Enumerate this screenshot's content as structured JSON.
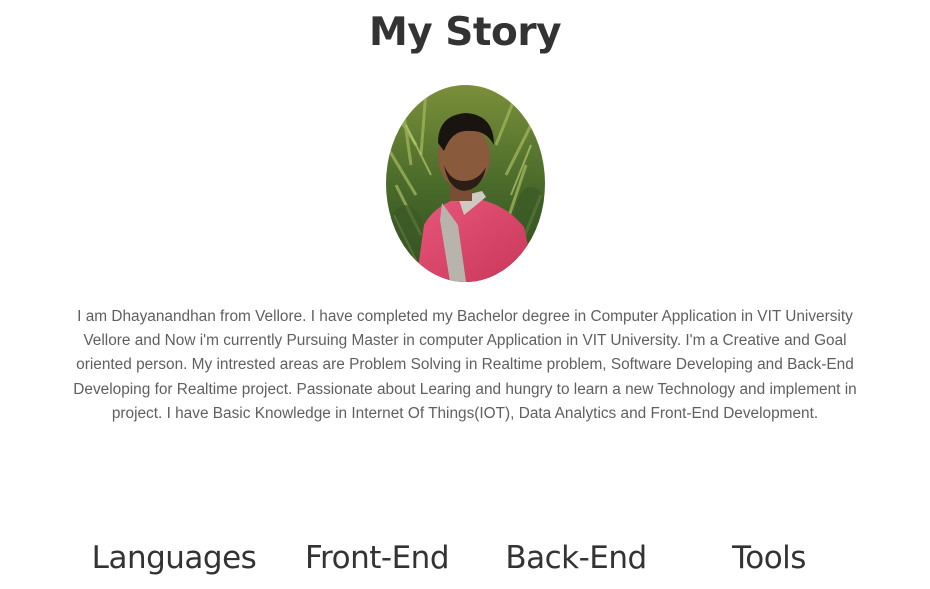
{
  "story": {
    "title": "My Story",
    "bio": "I am Dhayanandhan from Vellore. I have completed my Bachelor degree in Computer Application in VIT University Vellore and Now i'm currently Pursuing Master in computer Application in VIT University. I'm a Creative and Goal oriented person. My intrested areas are Problem Solving in Realtime problem, Software Developing and Back-End Developing for Realtime project. Passionate about Learing and hungry to learn a new Technology and implement in project. I have Basic Knowledge in Internet Of Things(IOT), Data Analytics and Front-End Development."
  },
  "skills": {
    "categories": [
      {
        "label": "Languages"
      },
      {
        "label": "Front-End"
      },
      {
        "label": "Back-End"
      },
      {
        "label": "Tools"
      }
    ]
  },
  "colors": {
    "heading": "#333333",
    "body_text": "#5f5f5f",
    "background": "#ffffff"
  }
}
